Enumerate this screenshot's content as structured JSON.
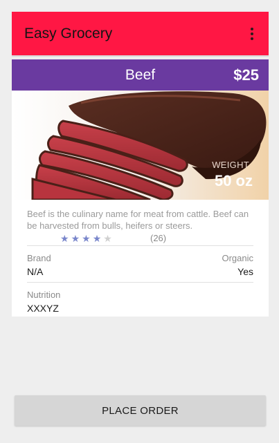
{
  "app": {
    "title": "Easy Grocery",
    "menu_icon": "more-vert-icon"
  },
  "colors": {
    "app_bar": "#ff1744",
    "product_header": "#6a3aa0",
    "star_active": "#7986cb",
    "button": "#d6d6d6"
  },
  "product": {
    "name": "Beef",
    "price": "$25",
    "image": "sliced-beef-roast",
    "weight_label": "WEIGHT",
    "weight_value": "50 oz",
    "description": "Beef is the culinary name for meat from cattle. Beef can be harvested from bulls, heifers or steers.",
    "rating": 4,
    "rating_max": 5,
    "review_count": "(26)",
    "brand_label": "Brand",
    "brand_value": "N/A",
    "organic_label": "Organic",
    "organic_value": "Yes",
    "nutrition_label": "Nutrition",
    "nutrition_value": "XXXYZ"
  },
  "actions": {
    "place_order": "PLACE ORDER"
  }
}
